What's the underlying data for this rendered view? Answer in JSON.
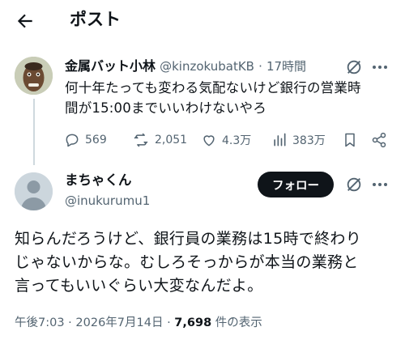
{
  "header": {
    "title": "ポスト"
  },
  "parent_post": {
    "author_name": "金属バット小林",
    "handle": "@kinzokubatKB",
    "separator": "·",
    "time_ago": "17時間",
    "text": "何十年たっても変わる気配ないけど銀行の営業時\n間が15:00までいいわけないやろ",
    "stats": {
      "replies": "569",
      "reposts": "2,051",
      "likes": "4.3万",
      "views": "383万"
    }
  },
  "main_post": {
    "author_name": "まちゃくん",
    "handle": "@inukurumu1",
    "follow_label": "フォロー",
    "text": "知らんだろうけど、銀行員の業務は15時で終わり\nじゃないからな。むしろそっからが本当の業務と\n言ってもいいぐらい大変なんだよ。",
    "timestamp": "午後7:03 · 2026年7月14日 · ",
    "view_count": "7,698",
    "view_suffix": " 件の表示"
  }
}
